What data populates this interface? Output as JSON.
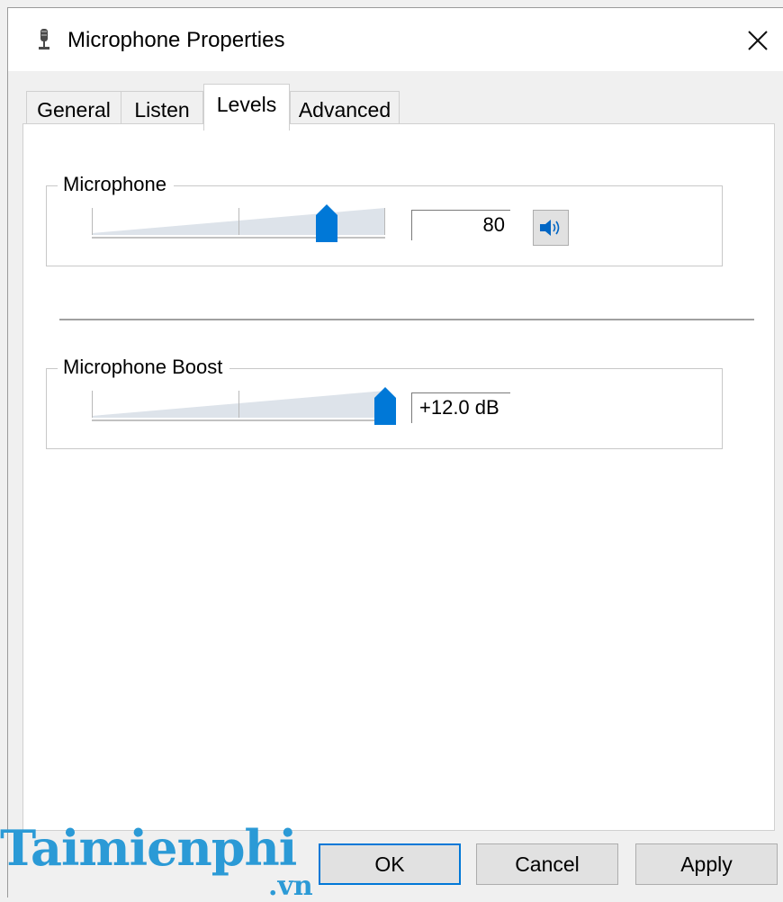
{
  "window": {
    "title": "Microphone Properties",
    "title_icon": "microphone-icon",
    "close_icon": "close-icon"
  },
  "tabs": [
    {
      "label": "General",
      "active": false
    },
    {
      "label": "Listen",
      "active": false
    },
    {
      "label": "Levels",
      "active": true
    },
    {
      "label": "Advanced",
      "active": false
    }
  ],
  "levels": {
    "microphone": {
      "label": "Microphone",
      "value": "80",
      "level_percent": 80,
      "mute_icon": "speaker-icon"
    },
    "boost": {
      "label": "Microphone Boost",
      "value": "+12.0 dB",
      "level_percent": 100
    }
  },
  "buttons": {
    "ok": "OK",
    "cancel": "Cancel",
    "apply": "Apply"
  },
  "watermark": {
    "main": "Taimienphi",
    "sub": ".vn"
  },
  "colors": {
    "accent": "#0078d7",
    "watermark": "#2b9ad6"
  }
}
